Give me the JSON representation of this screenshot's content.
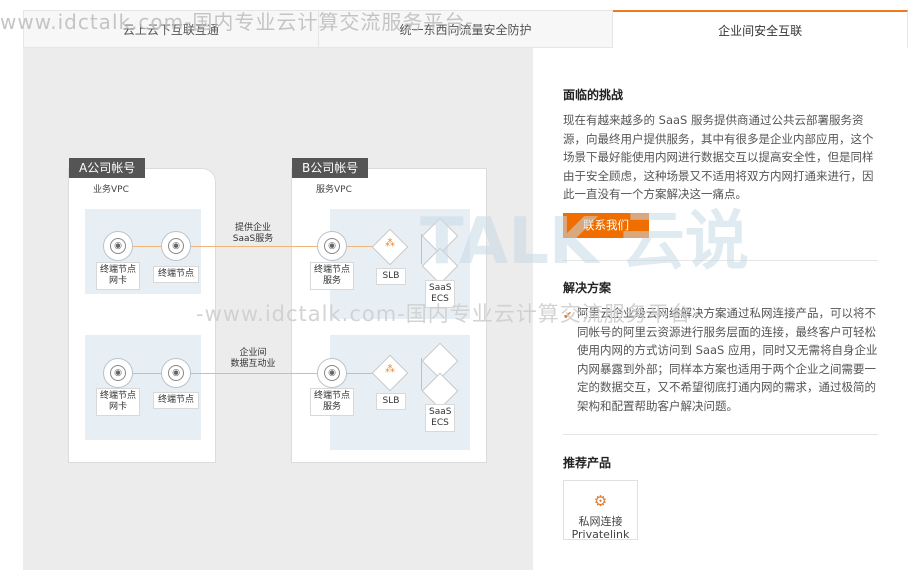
{
  "watermark": {
    "top": "www.idctalk.com-国内专业云计算交流服务平台-",
    "middle": "-www.idctalk.com-国内专业云计算交流服务平台-",
    "logo_text": "TALK 云说"
  },
  "tabs": [
    {
      "label": "云上云下互联互通",
      "active": false
    },
    {
      "label": "统一东西向流量安全防护",
      "active": false
    },
    {
      "label": "企业间安全互联",
      "active": true
    }
  ],
  "diagram": {
    "account_a": {
      "label": "A公司帐号",
      "vpc": "业务VPC"
    },
    "account_b": {
      "label": "B公司帐号",
      "vpc": "服务VPC"
    },
    "row1": {
      "left_nic": "终端节点\n网卡",
      "left_endpoint": "终端节点",
      "link_text": "提供企业\nSaaS服务",
      "right_service": "终端节点\n服务",
      "slb": "SLB",
      "ecs": "SaaS\nECS"
    },
    "row2": {
      "left_nic": "终端节点\n网卡",
      "left_endpoint": "终端节点",
      "link_text": "企业间\n数据互动业",
      "right_service": "终端节点\n服务",
      "slb": "SLB",
      "ecs": "SaaS\nECS"
    }
  },
  "info": {
    "challenge_title": "面临的挑战",
    "challenge_text": "现在有越来越多的 SaaS 服务提供商通过公共云部署服务资源，向最终用户提供服务，其中有很多是企业内部应用，这个场景下最好能使用内网进行数据交互以提高安全性，但是同样由于安全顾虑，这种场景又不适用将双方内网打通来进行，因此一直没有一个方案解决这一痛点。",
    "contact_button": "联系我们",
    "solution_title": "解决方案",
    "solution_text": "阿里云企业级云网络解决方案通过私网连接产品，可以将不同帐号的阿里云资源进行服务层面的连接，最终客户可轻松使用内网的方式访问到 SaaS 应用，同时又无需将自身企业内网暴露到外部；同样本方案也适用于两个企业之间需要一定的数据交互，又不希望彻底打通内网的需求，通过极简的架构和配置帮助客户解决问题。",
    "recommend_title": "推荐产品",
    "product": {
      "name": "私网连接",
      "name_en": "Privatelink"
    }
  },
  "colors": {
    "accent": "#f06e00",
    "tab_active_border": "#f07a20"
  }
}
